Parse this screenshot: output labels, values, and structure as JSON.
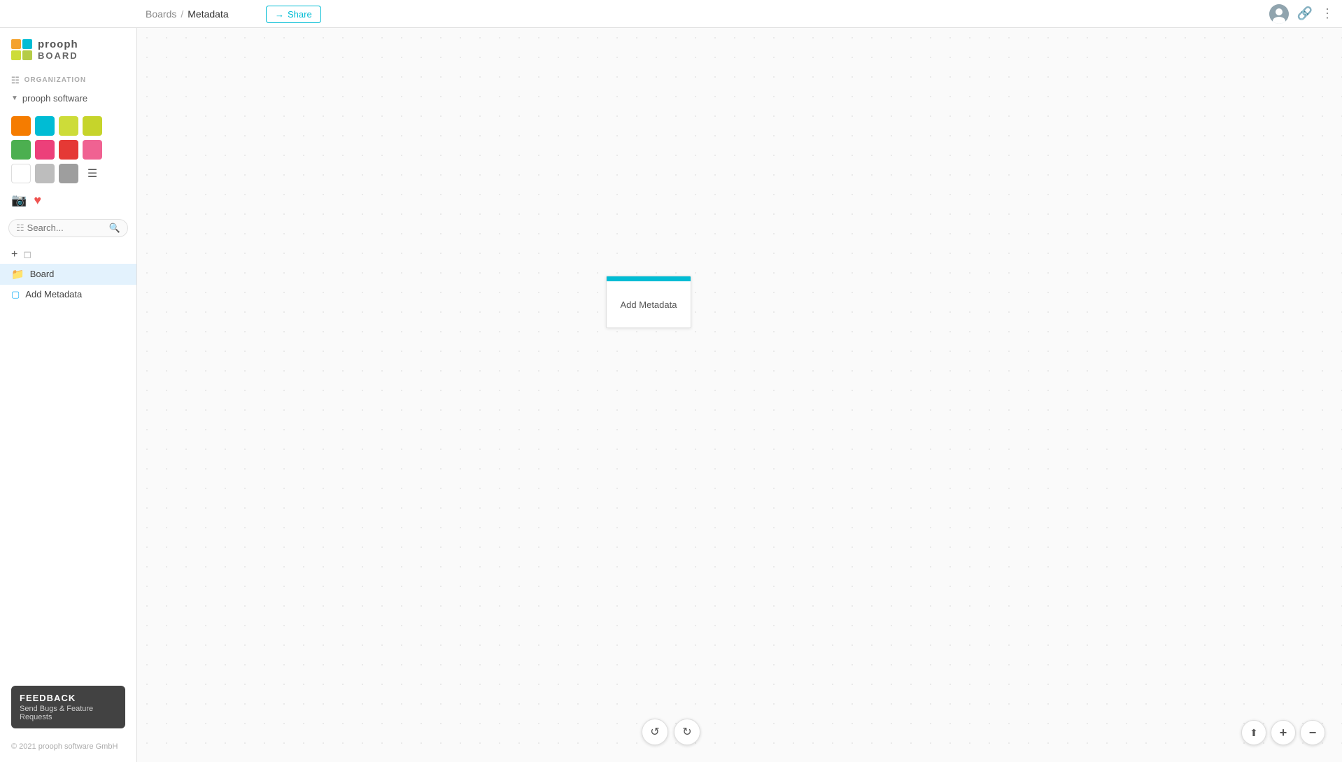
{
  "header": {
    "breadcrumb_boards": "Boards",
    "breadcrumb_sep": "/",
    "breadcrumb_current": "Metadata",
    "share_label": "Share"
  },
  "logo": {
    "prooph": "prooph",
    "board": "BOARD",
    "squares": [
      {
        "color": "#f4a22d"
      },
      {
        "color": "#00bcd4"
      },
      {
        "color": "#cddc39"
      },
      {
        "color": "#b5cc47"
      }
    ]
  },
  "sidebar": {
    "org_label": "ORGANIZATION",
    "org_item": "prooph software",
    "swatches": [
      {
        "color": "#f57c00",
        "name": "orange"
      },
      {
        "color": "#00bcd4",
        "name": "cyan"
      },
      {
        "color": "#cddc39",
        "name": "lime"
      },
      {
        "color": "#c6d42b",
        "name": "yellow-green"
      },
      {
        "color": "#4caf50",
        "name": "green"
      },
      {
        "color": "#ec407a",
        "name": "pink"
      },
      {
        "color": "#e53935",
        "name": "red"
      },
      {
        "color": "#f06292",
        "name": "light-pink"
      },
      {
        "color": "#ffffff",
        "name": "white"
      },
      {
        "color": "#bdbdbd",
        "name": "light-gray"
      },
      {
        "color": "#9e9e9e",
        "name": "gray"
      }
    ],
    "search_placeholder": "Search...",
    "nav_board": "Board",
    "nav_add_metadata": "Add Metadata",
    "feedback_title": "FEEDBACK",
    "feedback_sub": "Send Bugs & Feature Requests",
    "copyright": "© 2021 prooph software GmbH"
  },
  "canvas": {
    "card_label": "Add Metadata"
  },
  "toolbar": {
    "undo": "↺",
    "redo": "↻"
  },
  "zoom": {
    "cursor": "⬆",
    "zoom_in": "+",
    "zoom_out": "−"
  }
}
